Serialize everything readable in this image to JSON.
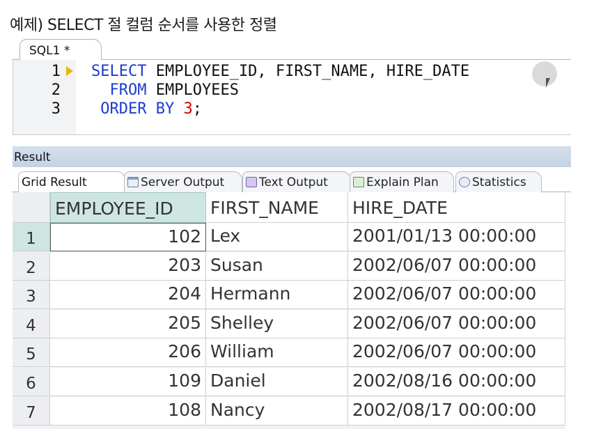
{
  "page_title": "예제) SELECT 절 컬럼 순서를 사용한 정렬",
  "editor": {
    "tab_label": "SQL1 *",
    "lines": [
      {
        "no": "1",
        "tokens": [
          {
            "t": "SELECT",
            "c": "kw"
          },
          {
            "t": " ",
            "c": "plain"
          },
          {
            "t": "EMPLOYEE_ID, FIRST_NAME, HIRE_DATE",
            "c": "plain"
          }
        ]
      },
      {
        "no": "2",
        "tokens": [
          {
            "t": "  FROM",
            "c": "kw"
          },
          {
            "t": " EMPLOYEES",
            "c": "plain"
          }
        ]
      },
      {
        "no": "3",
        "tokens": [
          {
            "t": " ORDER BY",
            "c": "kw"
          },
          {
            "t": " ",
            "c": "plain"
          },
          {
            "t": "3",
            "c": "num"
          },
          {
            "t": ";",
            "c": "plain"
          }
        ]
      }
    ]
  },
  "result": {
    "header": "Result",
    "tabs": [
      {
        "label": "Grid Result",
        "icon": "grid-icon",
        "active": true
      },
      {
        "label": "Server Output",
        "icon": "server-output-icon",
        "active": false
      },
      {
        "label": "Text Output",
        "icon": "text-output-icon",
        "active": false
      },
      {
        "label": "Explain Plan",
        "icon": "explain-plan-icon",
        "active": false
      },
      {
        "label": "Statistics",
        "icon": "statistics-icon",
        "active": false
      }
    ],
    "columns": [
      "EMPLOYEE_ID",
      "FIRST_NAME",
      "HIRE_DATE"
    ],
    "rows": [
      {
        "n": "1",
        "cells": [
          "102",
          "Lex",
          "2001/01/13 00:00:00"
        ]
      },
      {
        "n": "2",
        "cells": [
          "203",
          "Susan",
          "2002/06/07 00:00:00"
        ]
      },
      {
        "n": "3",
        "cells": [
          "204",
          "Hermann",
          "2002/06/07 00:00:00"
        ]
      },
      {
        "n": "4",
        "cells": [
          "205",
          "Shelley",
          "2002/06/07 00:00:00"
        ]
      },
      {
        "n": "5",
        "cells": [
          "206",
          "William",
          "2002/06/07 00:00:00"
        ]
      },
      {
        "n": "6",
        "cells": [
          "109",
          "Daniel",
          "2002/08/16 00:00:00"
        ]
      },
      {
        "n": "7",
        "cells": [
          "108",
          "Nancy",
          "2002/08/17 00:00:00"
        ]
      }
    ]
  },
  "colors": {
    "keyword": "#1c3ccf",
    "number": "#d40000",
    "selected_header": "#cfe6e0",
    "result_header": "#c9d6e6"
  }
}
